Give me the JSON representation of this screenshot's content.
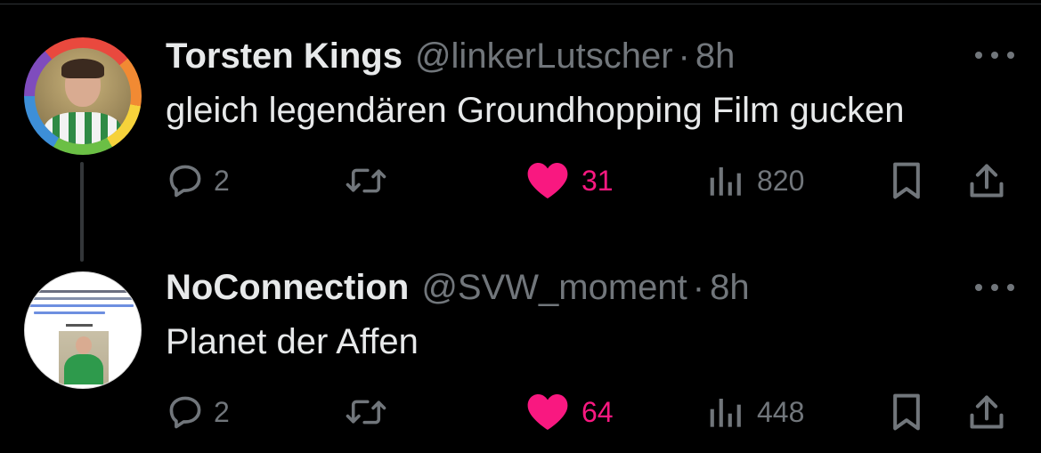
{
  "tweets": [
    {
      "display_name": "Torsten Kings",
      "handle": "@linkerLutscher",
      "separator": "·",
      "time": "8h",
      "text": "gleich legendären Groundhopping Film gucken",
      "avatar": "rainbow-ring-portrait",
      "replies": "2",
      "likes": "31",
      "views": "820"
    },
    {
      "display_name": "NoConnection",
      "handle": "@SVW_moment",
      "separator": "·",
      "time": "8h",
      "text": "Planet der Affen",
      "avatar": "wikipedia-screenshot-thumbnail",
      "replies": "2",
      "likes": "64",
      "views": "448"
    }
  ],
  "icons": {
    "reply": "reply-icon",
    "retweet": "retweet-icon",
    "like": "heart-icon",
    "views": "views-icon",
    "bookmark": "bookmark-icon",
    "share": "share-icon",
    "more": "more-icon"
  },
  "colors": {
    "background": "#000000",
    "text_primary": "#e7e9ea",
    "text_secondary": "#71767b",
    "like_active": "#f91880",
    "divider": "#2f3336"
  }
}
